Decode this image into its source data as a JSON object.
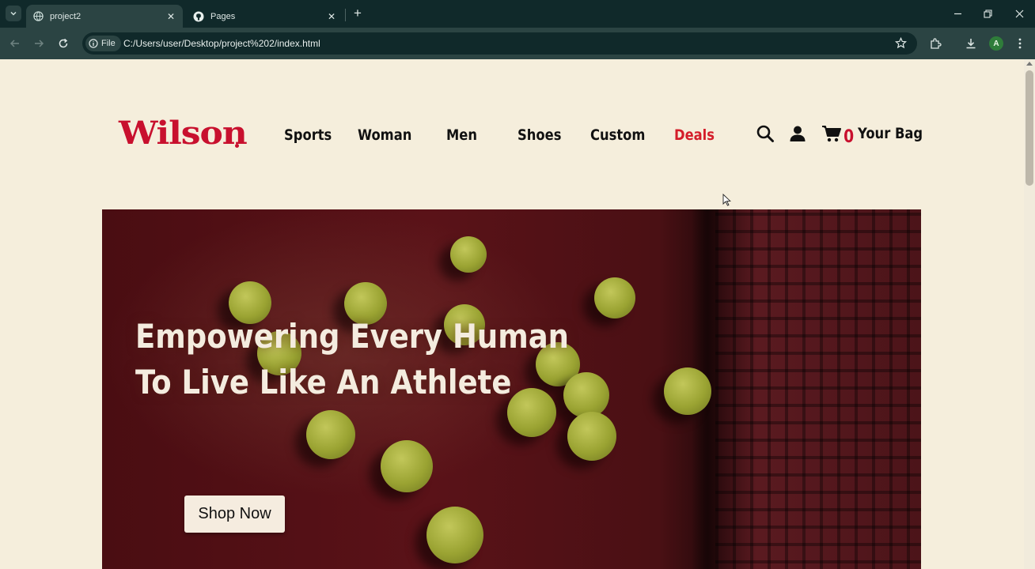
{
  "browser": {
    "tabs": [
      {
        "title": "project2",
        "active": true
      },
      {
        "title": "Pages",
        "active": false
      }
    ],
    "address": {
      "chip_label": "File",
      "url": "C:/Users/user/Desktop/project%202/index.html"
    },
    "profile_initial": "A"
  },
  "site": {
    "logo": "Wilson",
    "nav": [
      "Sports",
      "Woman",
      "Men",
      "Shoes",
      "Custom",
      "Deals"
    ],
    "cart_count": "0",
    "bag_label": "Your Bag",
    "colors": {
      "brand_red": "#c8102e",
      "page_bg": "#f5eedc",
      "hero_bg": "#4f1015"
    }
  },
  "hero": {
    "title_line1": "Empowering Every Human",
    "title_line2": "To Live Like An Athlete",
    "cta": "Shop Now"
  },
  "icons": {
    "nav_search": "search-icon",
    "nav_account": "user-icon",
    "nav_cart": "cart-icon"
  }
}
